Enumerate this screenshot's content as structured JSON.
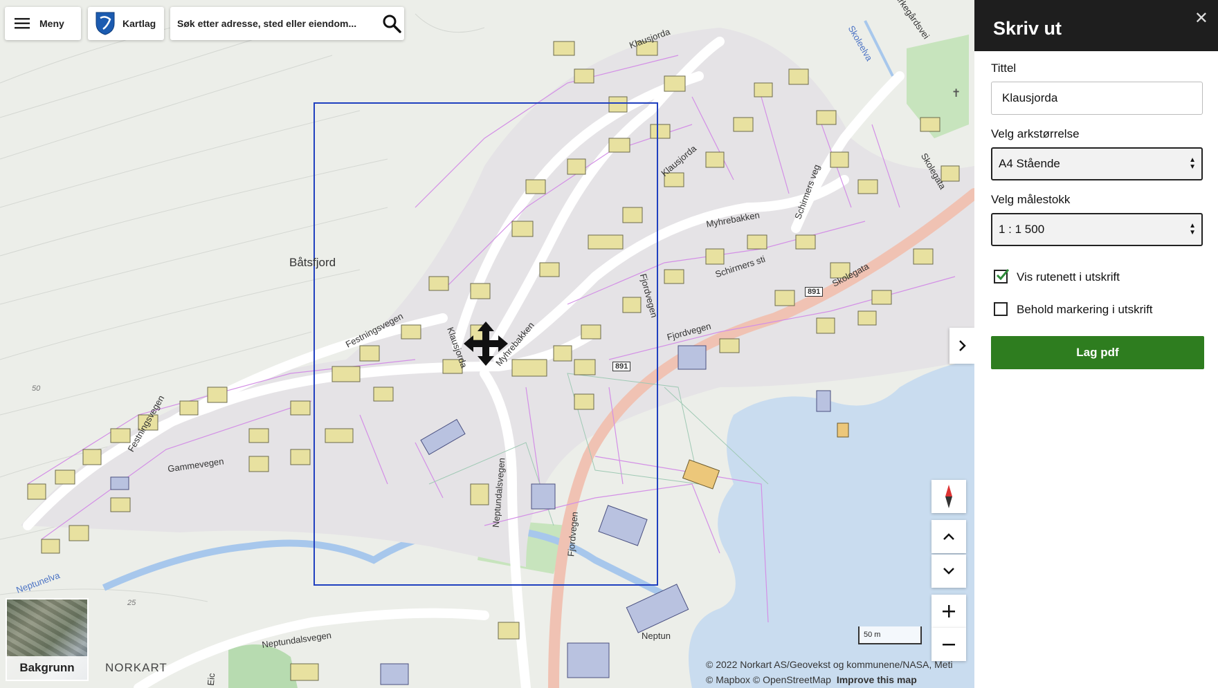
{
  "toolbar": {
    "menu_label": "Meny",
    "layers_label": "Kartlag"
  },
  "search": {
    "placeholder": "Søk etter adresse, sted eller eiendom..."
  },
  "map_labels": {
    "place": "Båtsfjord",
    "klausjorda": "Klausjorda",
    "myhrebakken": "Myhrebakken",
    "festningsvegen": "Festningsvegen",
    "gammevegen": "Gammevegen",
    "fjordvegen": "Fjordvegen",
    "neptundalsvegen": "Neptundalsvegen",
    "skolegata": "Skolegata",
    "schirmers_sti": "Schirmers sti",
    "schirmers_veg": "Schirmers veg",
    "skoleelva": "Skoleelva",
    "kirkegardsvei": "Kirkegårdsvei",
    "neptunelva": "Neptunelva",
    "neptun": "Neptun",
    "contour_50": "50",
    "contour_25": "25",
    "road_number": "891",
    "eic": "Eic"
  },
  "scale_bar": "50 m",
  "basemap": {
    "label": "Bakgrunn",
    "brand": "NORKART"
  },
  "attribution": {
    "line1": "© 2022 Norkart AS/Geovekst og kommunene/NASA, Meti",
    "line2": "© Mapbox © OpenStreetMap",
    "improve": "Improve this map"
  },
  "panel": {
    "title": "Skriv ut",
    "title_field_label": "Tittel",
    "title_value": "Klausjorda",
    "size_label": "Velg arkstørrelse",
    "size_value": "A4 Stående",
    "scale_label": "Velg målestokk",
    "scale_value": "1 : 1 500",
    "grid_label": "Vis rutenett i utskrift",
    "grid_checked": true,
    "keep_label": "Behold markering i utskrift",
    "keep_checked": false,
    "button": "Lag pdf"
  },
  "colors": {
    "accent_green": "#2e7d1f",
    "print_frame": "#1f3fbf",
    "header_dark": "#1e1e1e"
  }
}
